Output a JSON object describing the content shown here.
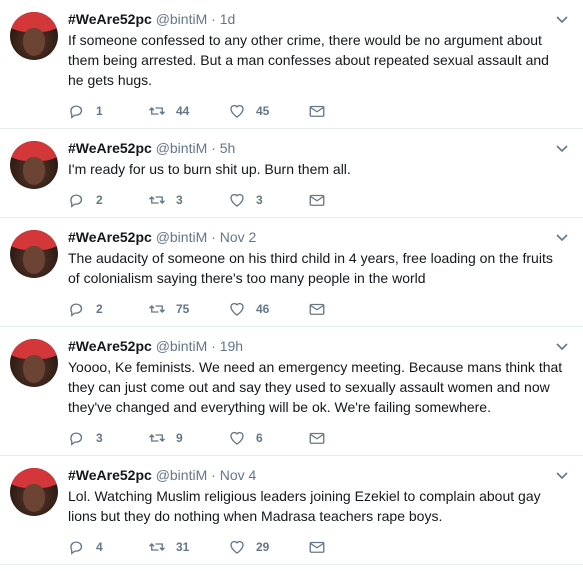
{
  "tweets": [
    {
      "name": "#WeAre52pc",
      "handle": "@bintiM",
      "time": "1d",
      "text": "If someone confessed to any other crime, there would be no argument about them being arrested. But a man confesses about repeated sexual assault and he gets hugs.",
      "replies": "1",
      "retweets": "44",
      "likes": "45"
    },
    {
      "name": "#WeAre52pc",
      "handle": "@bintiM",
      "time": "5h",
      "text": "I'm ready for us to burn shit up. Burn them all.",
      "replies": "2",
      "retweets": "3",
      "likes": "3"
    },
    {
      "name": "#WeAre52pc",
      "handle": "@bintiM",
      "time": "Nov 2",
      "text": "The audacity of someone on his third child in 4 years, free loading on the fruits of colonialism saying there's too many people in the world",
      "replies": "2",
      "retweets": "75",
      "likes": "46"
    },
    {
      "name": "#WeAre52pc",
      "handle": "@bintiM",
      "time": "19h",
      "text": "Yoooo, Ke feminists. We need an emergency meeting. Because mans think that they can just come out and say they used to sexually assault women and now they've changed and everything will be ok. We're failing somewhere.",
      "replies": "3",
      "retweets": "9",
      "likes": "6"
    },
    {
      "name": "#WeAre52pc",
      "handle": "@bintiM",
      "time": "Nov 4",
      "text": "Lol. Watching Muslim religious leaders joining Ezekiel to complain about gay lions but they do nothing when Madrasa teachers rape boys.",
      "replies": "4",
      "retweets": "31",
      "likes": "29"
    }
  ],
  "separator": "·",
  "icons": {
    "reply": "reply-icon",
    "retweet": "retweet-icon",
    "like": "heart-icon",
    "dm": "envelope-icon",
    "more": "chevron-down-icon"
  }
}
